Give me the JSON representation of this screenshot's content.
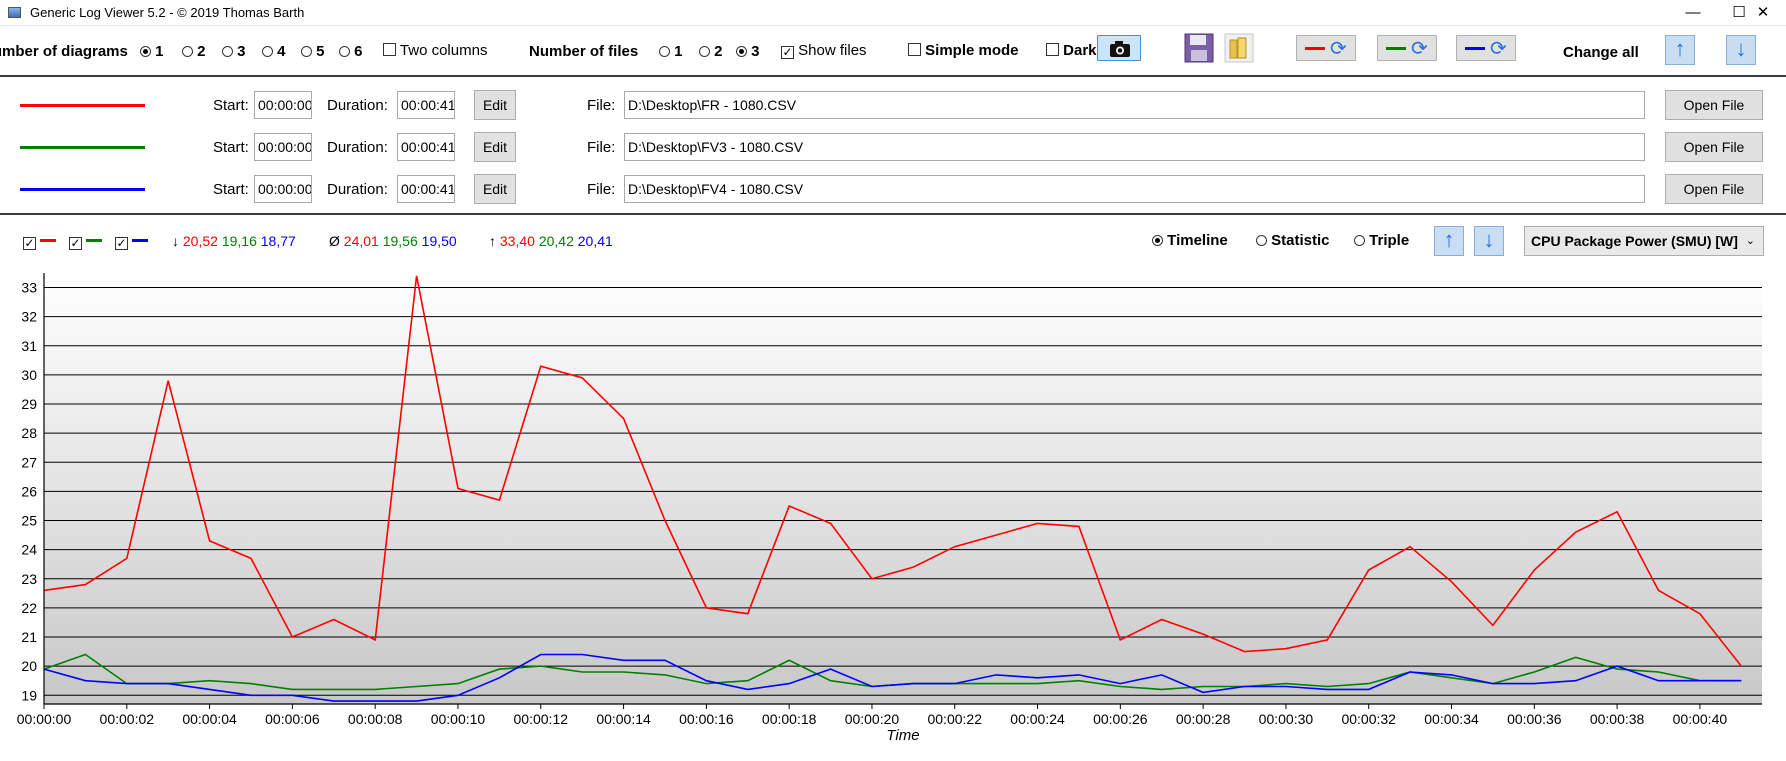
{
  "window": {
    "title": "Generic Log Viewer 5.2 - © 2019 Thomas Barth",
    "minimize": "—",
    "maximize": "☐",
    "close": "✕"
  },
  "toolbar": {
    "num_diagrams_label": "Number of diagrams",
    "diagram_options": [
      "1",
      "2",
      "3",
      "4",
      "5",
      "6"
    ],
    "diagram_selected": "1",
    "two_columns_label": "Two columns",
    "num_files_label": "Number of files",
    "file_options": [
      "1",
      "2",
      "3"
    ],
    "file_selected": "3",
    "show_files_label": "Show files",
    "simple_mode_label": "Simple mode",
    "dark_label": "Dark",
    "change_all_label": "Change all",
    "series_colors": [
      "#ff0000",
      "#008000",
      "#0000ff"
    ]
  },
  "files": [
    {
      "color": "#ff0000",
      "start_label": "Start:",
      "start": "00:00:00",
      "duration_label": "Duration:",
      "duration": "00:00:41",
      "edit": "Edit",
      "file_label": "File:",
      "path": "D:\\Desktop\\FR - 1080.CSV",
      "open": "Open File"
    },
    {
      "color": "#008000",
      "start_label": "Start:",
      "start": "00:00:00",
      "duration_label": "Duration:",
      "duration": "00:00:41",
      "edit": "Edit",
      "file_label": "File:",
      "path": "D:\\Desktop\\FV3 - 1080.CSV",
      "open": "Open File"
    },
    {
      "color": "#0000ff",
      "start_label": "Start:",
      "start": "00:00:00",
      "duration_label": "Duration:",
      "duration": "00:00:41",
      "edit": "Edit",
      "file_label": "File:",
      "path": "D:\\Desktop\\FV4 - 1080.CSV",
      "open": "Open File"
    }
  ],
  "stats": {
    "min_symbol": "↓",
    "min": [
      "20,52",
      "19,16",
      "18,77"
    ],
    "avg_symbol": "Ø",
    "avg": [
      "24,01",
      "19,56",
      "19,50"
    ],
    "max_symbol": "↑",
    "max": [
      "33,40",
      "20,42",
      "20,41"
    ]
  },
  "view": {
    "timeline": "Timeline",
    "statistic": "Statistic",
    "triple": "Triple",
    "selected": "Timeline",
    "sensor": "CPU Package Power (SMU) [W]"
  },
  "chart_data": {
    "type": "line",
    "xlabel": "Time",
    "ylabel": "",
    "ylim": [
      18.7,
      33.5
    ],
    "yticks": [
      19,
      20,
      21,
      22,
      23,
      24,
      25,
      26,
      27,
      28,
      29,
      30,
      31,
      32,
      33
    ],
    "xticks": [
      "00:00:00",
      "00:00:02",
      "00:00:04",
      "00:00:06",
      "00:00:08",
      "00:00:10",
      "00:00:12",
      "00:00:14",
      "00:00:16",
      "00:00:18",
      "00:00:20",
      "00:00:22",
      "00:00:24",
      "00:00:26",
      "00:00:28",
      "00:00:30",
      "00:00:32",
      "00:00:34",
      "00:00:36",
      "00:00:38",
      "00:00:40"
    ],
    "x": [
      0,
      1,
      2,
      3,
      4,
      5,
      6,
      7,
      8,
      9,
      10,
      11,
      12,
      13,
      14,
      15,
      16,
      17,
      18,
      19,
      20,
      21,
      22,
      23,
      24,
      25,
      26,
      27,
      28,
      29,
      30,
      31,
      32,
      33,
      34,
      35,
      36,
      37,
      38,
      39,
      40,
      41
    ],
    "grid": true,
    "series": [
      {
        "color": "#ff0000",
        "values": [
          22.6,
          22.8,
          23.7,
          29.8,
          24.3,
          23.7,
          21.0,
          21.6,
          20.9,
          33.4,
          26.1,
          25.7,
          30.3,
          29.9,
          28.5,
          25.0,
          22.0,
          21.8,
          25.5,
          24.9,
          23.0,
          23.4,
          24.1,
          24.5,
          24.9,
          24.8,
          20.9,
          21.6,
          21.1,
          20.5,
          20.6,
          20.9,
          23.3,
          24.1,
          22.9,
          21.4,
          23.3,
          24.6,
          25.3,
          22.6,
          21.8,
          20.0
        ]
      },
      {
        "color": "#008000",
        "values": [
          19.9,
          20.4,
          19.4,
          19.4,
          19.5,
          19.4,
          19.2,
          19.2,
          19.2,
          19.3,
          19.4,
          19.9,
          20.0,
          19.8,
          19.8,
          19.7,
          19.4,
          19.5,
          20.2,
          19.5,
          19.3,
          19.4,
          19.4,
          19.4,
          19.4,
          19.5,
          19.3,
          19.2,
          19.3,
          19.3,
          19.4,
          19.3,
          19.4,
          19.8,
          19.6,
          19.4,
          19.8,
          20.3,
          19.9,
          19.8,
          19.5,
          19.5
        ]
      },
      {
        "color": "#0000ff",
        "values": [
          19.9,
          19.5,
          19.4,
          19.4,
          19.2,
          19.0,
          19.0,
          18.8,
          18.8,
          18.8,
          19.0,
          19.6,
          20.4,
          20.4,
          20.2,
          20.2,
          19.5,
          19.2,
          19.4,
          19.9,
          19.3,
          19.4,
          19.4,
          19.7,
          19.6,
          19.7,
          19.4,
          19.7,
          19.1,
          19.3,
          19.3,
          19.2,
          19.2,
          19.8,
          19.7,
          19.4,
          19.4,
          19.5,
          20.0,
          19.5,
          19.5,
          19.5
        ]
      }
    ]
  }
}
